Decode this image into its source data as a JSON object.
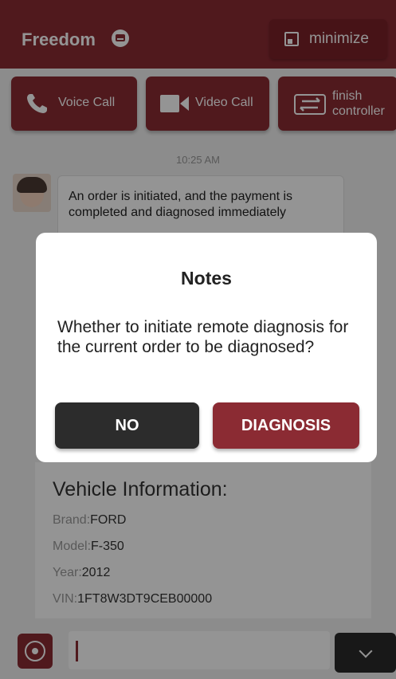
{
  "header": {
    "app_title": "Freedom",
    "minimize_label": "minimize"
  },
  "actions": {
    "voice_call": "Voice Call",
    "video_call": "Video Call",
    "finish_line1": "finish",
    "finish_line2": "controller"
  },
  "chat": {
    "timestamp": "10:25 AM",
    "message": "An order is initiated, and the payment is completed and diagnosed immediately"
  },
  "vehicle": {
    "title": "Vehicle Information:",
    "brand_key": "Brand:",
    "brand": "FORD",
    "model_key": "Model:",
    "model": "F-350",
    "year_key": "Year:",
    "year": "2012",
    "vin_key": "VIN:",
    "vin": "1FT8W3DT9CEB00000"
  },
  "dialog": {
    "title": "Notes",
    "message": "Whether to initiate remote diagnosis for the current order to be diagnosed?",
    "no_label": "NO",
    "confirm_label": "DIAGNOSIS"
  },
  "colors": {
    "brand": "#8b2b33",
    "dark_button": "#2c2c2c"
  },
  "icons": {
    "title": "card-icon",
    "minimize": "minimize-icon",
    "voice": "phone-icon",
    "video": "video-camera-icon",
    "finish": "switch-arrows-icon",
    "input_voice": "voice-input-icon",
    "more": "chevron-down-icon"
  }
}
